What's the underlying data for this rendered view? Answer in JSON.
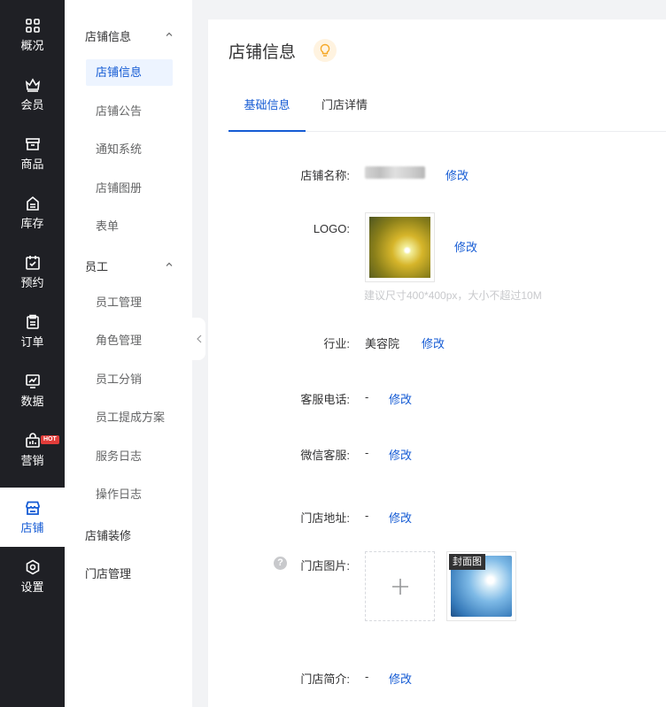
{
  "nav": {
    "items": [
      {
        "label": "概况",
        "icon": "dashboard-icon"
      },
      {
        "label": "会员",
        "icon": "crown-icon"
      },
      {
        "label": "商品",
        "icon": "product-box-icon"
      },
      {
        "label": "库存",
        "icon": "inventory-icon"
      },
      {
        "label": "预约",
        "icon": "calendar-check-icon"
      },
      {
        "label": "订单",
        "icon": "clipboard-icon"
      },
      {
        "label": "数据",
        "icon": "chart-icon"
      },
      {
        "label": "营销",
        "icon": "shop-bag-icon"
      },
      {
        "label": "店铺",
        "icon": "store-icon"
      },
      {
        "label": "设置",
        "icon": "settings-icon"
      }
    ],
    "active_index": 8,
    "hot_badge": "HOT"
  },
  "subnav": {
    "group1": "店铺信息",
    "group1_items": [
      "店铺信息",
      "店铺公告",
      "通知系统",
      "店铺图册",
      "表单"
    ],
    "group2": "员工",
    "group2_items": [
      "员工管理",
      "角色管理",
      "员工分销",
      "员工提成方案",
      "服务日志",
      "操作日志"
    ],
    "extra1": "店铺装修",
    "extra2": "门店管理"
  },
  "main": {
    "title": "店铺信息",
    "tabs": [
      "基础信息",
      "门店详情"
    ],
    "active_tab": 0,
    "fields": {
      "name_label": "店铺名称:",
      "logo_label": "LOGO:",
      "logo_hint": "建议尺寸400*400px，大小不超过10M",
      "industry_label": "行业:",
      "industry_value": "美容院",
      "phone_label": "客服电话:",
      "phone_value": "-",
      "wechat_label": "微信客服:",
      "wechat_value": "-",
      "address_label": "门店地址:",
      "address_value": "-",
      "images_label": "门店图片:",
      "cover_tag": "封面图",
      "intro_label": "门店简介:",
      "intro_value": "-",
      "edit": "修改",
      "upload_plus": "+"
    }
  },
  "colors": {
    "primary": "#155bd4",
    "nav_bg": "#1f2025",
    "hot": "#e23c39"
  }
}
